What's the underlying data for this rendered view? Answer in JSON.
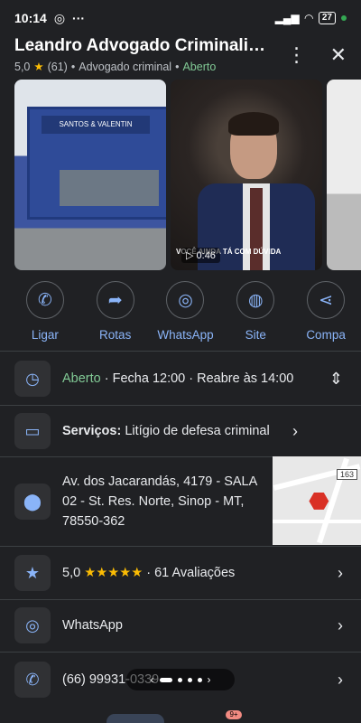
{
  "status": {
    "time": "10:14",
    "battery": "27"
  },
  "header": {
    "title": "Leandro Advogado Criminalis...",
    "rating": "5,0",
    "reviews": "(61)",
    "category": "Advogado criminal",
    "open": "Aberto",
    "separator": "•"
  },
  "photos": {
    "video_time": "0:46",
    "video_caption": "VOCÊ AINDA TÁ COM DÚVIDA",
    "sign_text": "SANTOS & VALENTIN"
  },
  "actions": [
    {
      "label": "Ligar",
      "icon": "phone-icon"
    },
    {
      "label": "Rotas",
      "icon": "directions-icon"
    },
    {
      "label": "WhatsApp",
      "icon": "whatsapp-icon"
    },
    {
      "label": "Site",
      "icon": "globe-icon"
    },
    {
      "label": "Compa",
      "icon": "share-icon"
    }
  ],
  "hours": {
    "status": "Aberto",
    "details": " · Fecha 12:00 · Reabre às 14:00"
  },
  "services": {
    "label": "Serviços:",
    "value": " Litígio de defesa criminal"
  },
  "address": {
    "line": "Av. dos Jacarandás, 4179 - SALA 02 - St. Res. Norte, Sinop - MT, 78550-362",
    "map_badge": "163"
  },
  "reviews_row": {
    "rating": "5,0",
    "stars": "★★★★★",
    "text": " · 61 Avaliações"
  },
  "whatsapp_row": {
    "label": "WhatsApp"
  },
  "phone_row": {
    "number": "(66) 99931-0339"
  },
  "nav": {
    "badge": "9+"
  },
  "colors": {
    "accent": "#8ab4f8",
    "open": "#81c995",
    "star": "#fbbc04",
    "background": "#202124"
  }
}
